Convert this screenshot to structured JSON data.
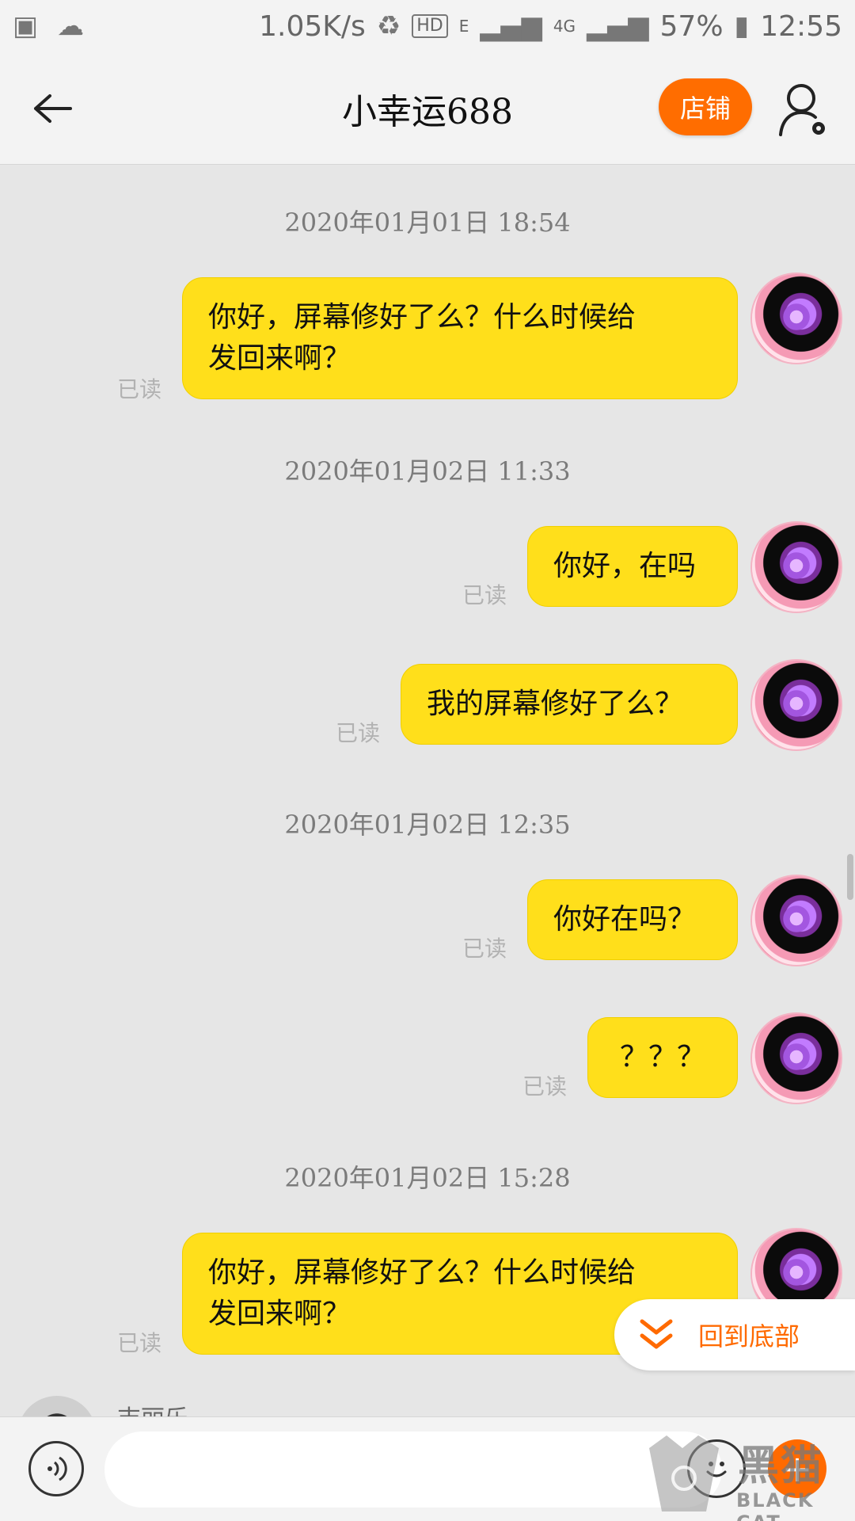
{
  "status_bar": {
    "speed": "1.05K/s",
    "hd": "HD",
    "net_e": "E",
    "net_4g": "4G",
    "battery": "57%",
    "time": "12:55"
  },
  "header": {
    "title": "小幸运688",
    "shop_button": "店铺"
  },
  "chat": {
    "timestamps": [
      "2020年01月01日 18:54",
      "2020年01月02日 11:33",
      "2020年01月02日 12:35",
      "2020年01月02日 15:28"
    ],
    "messages": [
      {
        "text_line1": "你好，屏幕修好了么？什么时候给",
        "text_line2": "发回来啊？",
        "status": "已读"
      },
      {
        "text": "你好，在吗",
        "status": "已读"
      },
      {
        "text": "我的屏幕修好了么？",
        "status": "已读"
      },
      {
        "text": "你好在吗？",
        "status": "已读"
      },
      {
        "text": "？？？",
        "status": "已读"
      },
      {
        "text_line1": "你好，屏幕修好了么？什么时候给",
        "text_line2": "发回来啊？",
        "status": "已读"
      }
    ],
    "partial_sender_name": "吉丽乐"
  },
  "back_to_bottom": "回到底部",
  "input": {
    "placeholder": ""
  },
  "watermark": {
    "top": "黑猫",
    "bottom": "BLACK CAT"
  },
  "colors": {
    "bubble": "#ffdf1b",
    "accent": "#ff6a00",
    "background": "#e6e6e6"
  }
}
